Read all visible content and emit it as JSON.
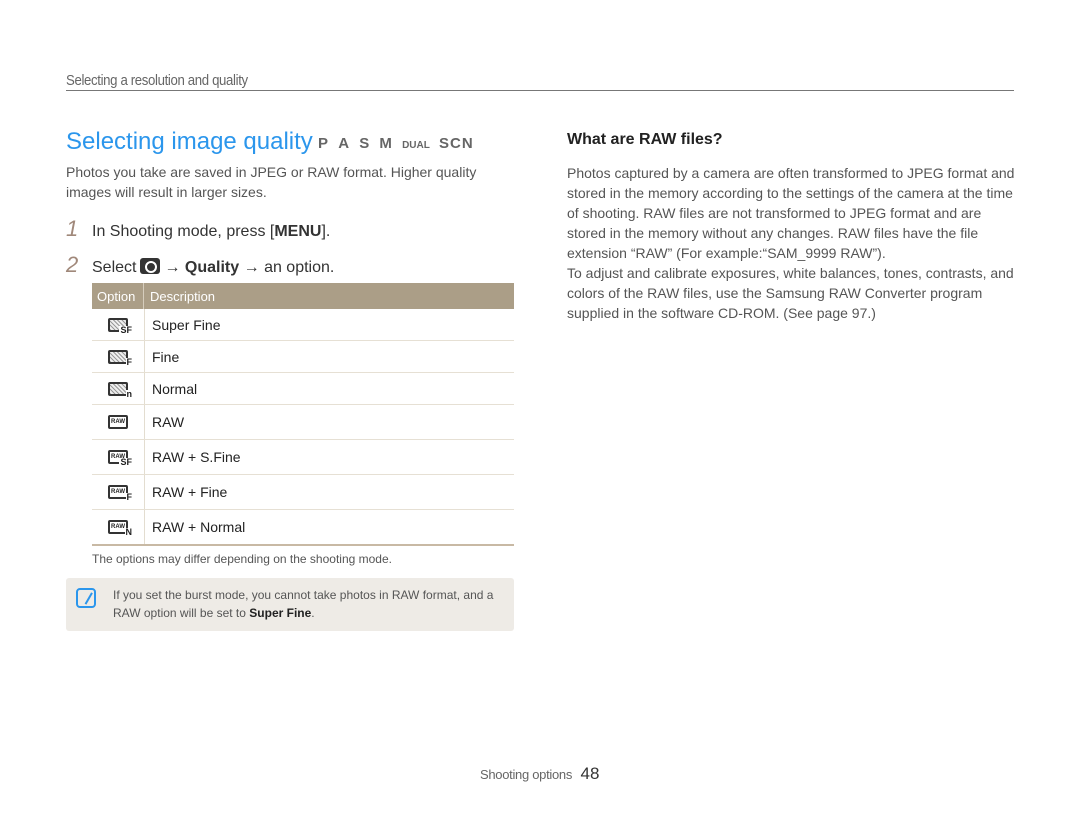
{
  "header": {
    "section_title": "Selecting a resolution and quality"
  },
  "main": {
    "title": "Selecting image quality",
    "modes": [
      "P",
      "A",
      "S",
      "M",
      "DUAL",
      "SCN"
    ],
    "intro": "Photos you take are saved in JPEG or RAW format. Higher quality images will result in larger sizes.",
    "steps": [
      {
        "num": "1",
        "prefix": "In Shooting mode, press [",
        "key": "MENU",
        "suffix": "]."
      },
      {
        "num": "2",
        "prefix": "Select",
        "arrow1": "→",
        "bold": "Quality",
        "arrow2": "→",
        "suffix": "an option."
      }
    ],
    "table": {
      "headers": [
        "Option",
        "Description"
      ],
      "rows": [
        {
          "icon": "super-fine-icon",
          "icon_label": "",
          "icon_sub": "SF",
          "description": "Super Fine"
        },
        {
          "icon": "fine-icon",
          "icon_label": "",
          "icon_sub": "F",
          "description": "Fine"
        },
        {
          "icon": "normal-icon",
          "icon_label": "",
          "icon_sub": "n",
          "description": "Normal"
        },
        {
          "icon": "raw-icon",
          "icon_label": "RAW",
          "icon_sub": "",
          "description": "RAW"
        },
        {
          "icon": "raw-super-fine-icon",
          "icon_label": "RAW",
          "icon_sub": "SF",
          "description": "RAW + S.Fine"
        },
        {
          "icon": "raw-fine-icon",
          "icon_label": "RAW",
          "icon_sub": "F",
          "description": "RAW + Fine"
        },
        {
          "icon": "raw-normal-icon",
          "icon_label": "RAW",
          "icon_sub": "N",
          "description": "RAW + Normal"
        }
      ]
    },
    "table_note": "The options may differ depending on the shooting mode.",
    "note": {
      "text_before": "If you set the burst mode, you cannot take photos in RAW format, and a RAW option will be set to ",
      "bold": "Super Fine",
      "text_after": "."
    }
  },
  "sidebar": {
    "title": "What are RAW files?",
    "paragraphs": [
      "Photos captured by a camera are often transformed to JPEG format and stored in the memory according to the settings of the camera at the time of shooting. RAW files are not transformed to JPEG format and are stored in the memory without any changes. RAW files have the file extension “RAW” (For example:“SAM_9999 RAW”).",
      "To adjust and calibrate exposures, white balances, tones, contrasts, and colors of the RAW files, use the Samsung RAW Converter program supplied in the software CD-ROM. (See page 97.)"
    ]
  },
  "footer": {
    "section": "Shooting options",
    "page": "48"
  },
  "colors": {
    "accent": "#2b96ec",
    "table_header": "#ab9e87",
    "note_bg": "#eeebe6"
  }
}
